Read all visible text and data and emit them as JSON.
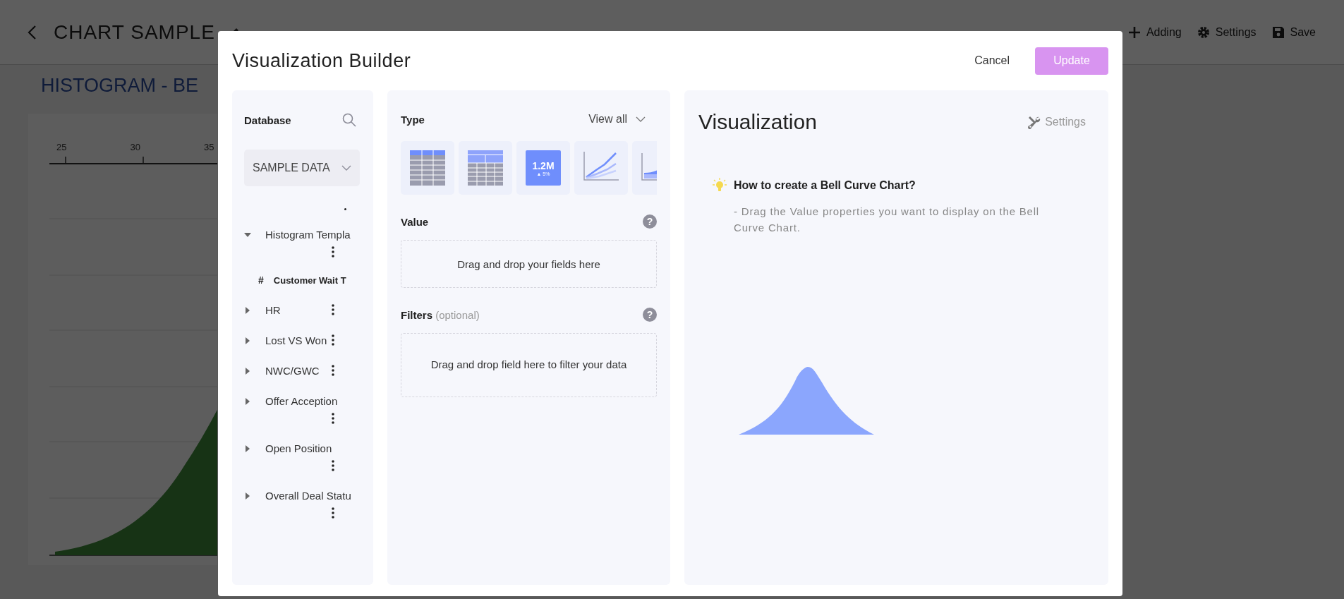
{
  "background": {
    "title": "CHART SAMPLE",
    "toolbar": [
      {
        "kind": "plus",
        "label": "Adding"
      },
      {
        "kind": "gear",
        "label": "Settings"
      },
      {
        "kind": "save",
        "label": "Save"
      }
    ],
    "chart_title": "HISTOGRAM - BE",
    "axis_ticks": [
      "25",
      "30",
      "35"
    ]
  },
  "modal": {
    "title": "Visualization Builder",
    "cancel": "Cancel",
    "update": {
      "label": "Update",
      "disabled": true
    }
  },
  "database": {
    "label": "Database",
    "source": "SAMPLE DATA",
    "tree": [
      {
        "name": "Histogram Templa",
        "expanded": true,
        "children": [
          {
            "symbol": "#",
            "name": "Customer Wait T"
          }
        ]
      },
      {
        "name": "HR",
        "expanded": false
      },
      {
        "name": "Lost VS Won",
        "expanded": false
      },
      {
        "name": "NWC/GWC",
        "expanded": false
      },
      {
        "name": "Offer Acception",
        "expanded": false
      },
      {
        "name": "Open Position",
        "expanded": false
      },
      {
        "name": "Overall Deal Statu",
        "expanded": false
      }
    ]
  },
  "type": {
    "label": "Type",
    "view_all": "View all",
    "options": [
      {
        "kind": "table"
      },
      {
        "kind": "pivot"
      },
      {
        "kind": "kpi",
        "value": "1.2M",
        "delta": "▲ 5%"
      },
      {
        "kind": "line"
      },
      {
        "kind": "area"
      }
    ]
  },
  "value": {
    "label": "Value",
    "help": "?",
    "dropzone": "Drag and drop your fields here"
  },
  "filters": {
    "label": "Filters",
    "hint": "(optional)",
    "help": "?",
    "dropzone": "Drag and drop field here to filter your data"
  },
  "visualization": {
    "title": "Visualization",
    "settings": "Settings",
    "tip_title": "How to create a Bell Curve Chart?",
    "tip_text": "- Drag the Value properties you want to display on the Bell Curve Chart."
  }
}
